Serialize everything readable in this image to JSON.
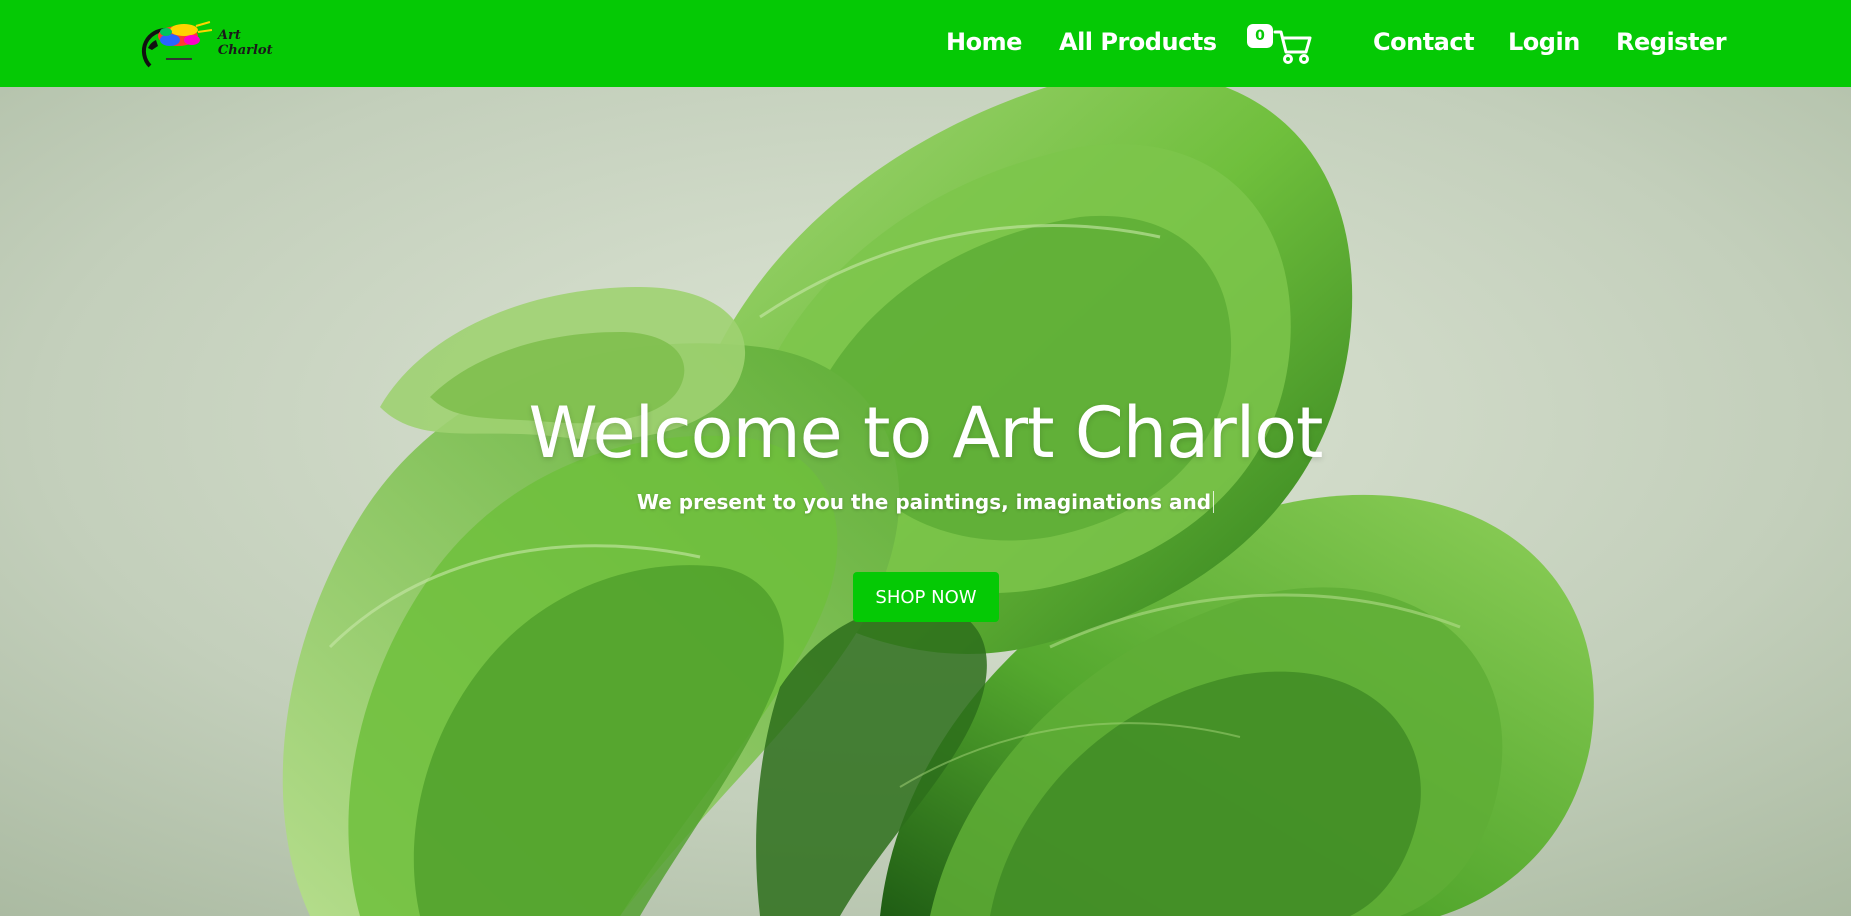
{
  "brand": {
    "name": "Art Charlot",
    "nav_color": "#05c905"
  },
  "nav": {
    "home": "Home",
    "all_products": "All Products",
    "cart_count": "0",
    "cart_icon": "shopping-cart-icon",
    "contact": "Contact",
    "login": "Login",
    "register": "Register"
  },
  "hero": {
    "title": "Welcome to Art Charlot",
    "subtitle": "We present to you the paintings, imaginations and",
    "button": "SHOP NOW"
  }
}
